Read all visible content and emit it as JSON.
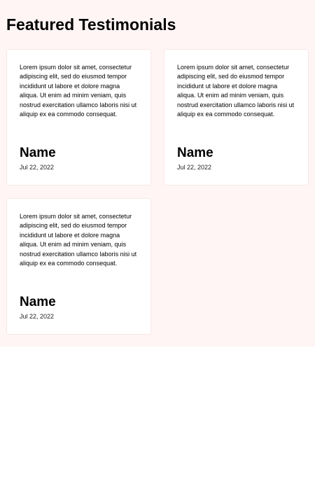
{
  "section": {
    "title": "Featured Testimonials"
  },
  "testimonials": [
    {
      "quote": "Lorem ipsum dolor sit amet, consectetur adipiscing elit, sed do eiusmod tempor incididunt ut labore et dolore magna aliqua. Ut enim ad minim veniam, quis nostrud exercitation ullamco laboris nisi ut aliquip ex ea commodo consequat.",
      "name": "Name",
      "date": "Jul 22, 2022"
    },
    {
      "quote": "Lorem ipsum dolor sit amet, consectetur adipiscing elit, sed do eiusmod tempor incididunt ut labore et dolore magna aliqua. Ut enim ad minim veniam, quis nostrud exercitation ullamco laboris nisi ut aliquip ex ea commodo consequat.",
      "name": "Name",
      "date": "Jul 22, 2022"
    },
    {
      "quote": "Lorem ipsum dolor sit amet, consectetur adipiscing elit, sed do eiusmod tempor incididunt ut labore et dolore magna aliqua. Ut enim ad minim veniam, quis nostrud exercitation ullamco laboris nisi ut aliquip ex ea commodo consequat.",
      "name": "Name",
      "date": "Jul 22, 2022"
    }
  ],
  "colors": {
    "section_background": "#fff5f5",
    "card_background": "#ffffff",
    "text": "#000000"
  }
}
